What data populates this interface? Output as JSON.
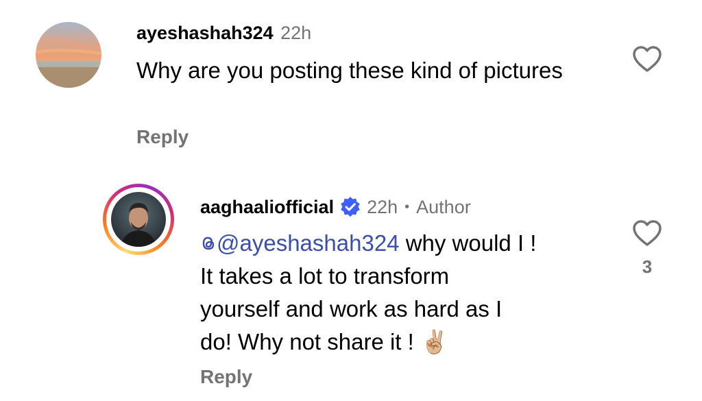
{
  "comments": [
    {
      "username": "ayeshashah324",
      "time": "22h",
      "text": "Why are you posting these kind of pictures",
      "reply_label": "Reply"
    },
    {
      "username": "aaghaaliofficial",
      "time": "22h",
      "separator": "•",
      "author_label": "Author",
      "mention": "@ayeshashah324",
      "line1_rest": " why would I !",
      "line2": "It takes a lot to transform",
      "line3": "yourself and work as hard as I",
      "line4": "do! Why not share it ! ",
      "emoji": "✌🏼",
      "reply_label": "Reply",
      "like_count": "3"
    }
  ],
  "icons": {
    "heart": "heart-icon",
    "verified": "verified-badge-icon",
    "threads": "threads-icon"
  },
  "colors": {
    "muted": "#737373",
    "mention": "#3b4ea8",
    "verified": "#3f5efb",
    "story_ring_start": "#feda75",
    "story_ring_end": "#d62976"
  }
}
